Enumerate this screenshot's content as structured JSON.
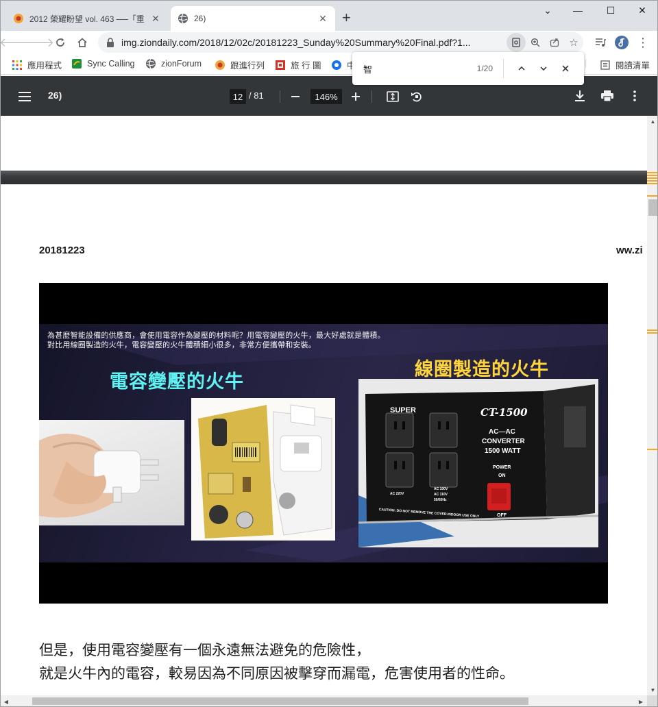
{
  "tabs": [
    {
      "title": "2012 榮耀盼望 vol. 463 ──「重",
      "active": false
    },
    {
      "title": "26)",
      "active": true
    }
  ],
  "new_tab_label": "+",
  "window_controls": {
    "minimize": "⌄",
    "restore": "—",
    "maximize": "☐",
    "close": "✕"
  },
  "address_bar": {
    "url": "img.ziondaily.com/2018/12/02c/20181223_Sunday%20Summary%20Final.pdf?1..."
  },
  "bookmarks": [
    {
      "label": "應用程式",
      "icon": "apps-grid-icon"
    },
    {
      "label": "Sync Calling",
      "icon": "sync-calling-icon"
    },
    {
      "label": "zionForum",
      "icon": "globe-icon"
    },
    {
      "label": "跟進行列",
      "icon": "bookmark-favicon-icon"
    },
    {
      "label": "旅 行 圖",
      "icon": "travel-favicon-icon"
    },
    {
      "label": "中",
      "icon": "bookmark-favicon-icon"
    }
  ],
  "reading_list": "閱讀清單",
  "find_bar": {
    "query": "智",
    "count": "1/20"
  },
  "pdf_toolbar": {
    "title": "26)",
    "current_page": "12",
    "total_pages": "/ 81",
    "zoom": "146%"
  },
  "page": {
    "date": "20181223",
    "site": "ww.zi",
    "figure": {
      "caption_line1": "為甚麼智能設備的供應商，會使用電容作為變壓的材料呢？用電容變壓的火牛，最大好處就是體積。",
      "caption_line2": "對比用線圈製造的火牛，電容變壓的火牛體積細小很多，非常方便攜帶和安裝。",
      "label_left": "電容變壓的火牛",
      "label_right": "線圈製造的火牛",
      "converter": {
        "brand": "SUPER",
        "model": "CT-1500",
        "line1": "AC—AC",
        "line2": "CONVERTER",
        "line3": "1500 WATT",
        "power": "POWER",
        "on": "ON",
        "off": "OFF",
        "caution": "CAUTION: DO NOT REMOVE THE COVER.INDOOR USE ONLY",
        "volt_220": "AC 220V",
        "volt_100": "AC 100V",
        "volt_110": "AC 110V",
        "freq": "50/60Hz"
      }
    },
    "body_line1": "但是，使用電容變壓有一個永遠無法避免的危險性，",
    "body_line2": "就是火牛內的電容，較易因為不同原因被擊穿而漏電，危害使用者的性命。"
  },
  "colors": {
    "pdf_toolbar": "#323639",
    "tab_strip": "#dee1e6",
    "find_marker": "#f5a623",
    "caption_cyan": "#5ff2f2",
    "caption_yellow": "#ffd53a"
  }
}
